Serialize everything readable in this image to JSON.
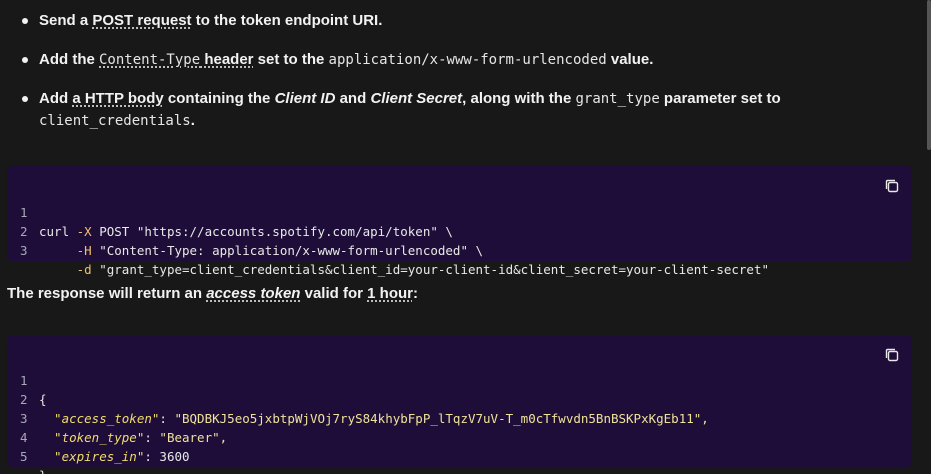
{
  "bullets": [
    {
      "parts": {
        "a": "Send a ",
        "link": "POST request",
        "b": " to the token endpoint URI."
      }
    },
    {
      "parts": {
        "a": "Add the ",
        "code1": "Content-Type",
        "link": " header",
        "b": " set to the ",
        "code2": "application/x-www-form-urlencoded",
        "c": " value."
      }
    },
    {
      "parts": {
        "a": "Add ",
        "link": "a HTTP body",
        "b": " containing the ",
        "i1": "Client ID",
        "c": " and ",
        "i2": "Client Secret",
        "d": ", along with the ",
        "code1": "grant_type",
        "e": " parameter set to",
        "code2": "client_credentials",
        "f": "."
      }
    }
  ],
  "code_block_1": {
    "lines": [
      {
        "n": "1",
        "cmd": "curl",
        "flag": " -X",
        "rest": " POST \"https://accounts.spotify.com/api/token\" \\"
      },
      {
        "n": "2",
        "cmd": "",
        "flag": "     -H",
        "rest": " \"Content-Type: application/x-www-form-urlencoded\" \\"
      },
      {
        "n": "3",
        "cmd": "",
        "flag": "     -d",
        "rest": " \"grant_type=client_credentials&client_id=your-client-id&client_secret=your-client-secret\""
      }
    ]
  },
  "response_text": {
    "a": "The response will return an ",
    "link1": "access token",
    "b": " valid for ",
    "link2": "1 hour",
    "c": ":"
  },
  "code_block_2": {
    "lines": [
      {
        "n": "1",
        "key": "",
        "sep": "{",
        "val": ""
      },
      {
        "n": "2",
        "key": "  \"access_token\"",
        "sep": ": ",
        "val": "\"BQDBKJ5eo5jxbtpWjVOj7ryS84khybFpP_lTqzV7uV-T_m0cTfwvdn5BnBSKPxKgEb11\","
      },
      {
        "n": "3",
        "key": "  \"token_type\"",
        "sep": ": ",
        "val": "\"Bearer\","
      },
      {
        "n": "4",
        "key": "  \"expires_in\"",
        "sep": ": ",
        "val": "3600"
      },
      {
        "n": "5",
        "key": "",
        "sep": "}",
        "val": ""
      }
    ]
  },
  "icons": {
    "copy": "copy-icon"
  }
}
